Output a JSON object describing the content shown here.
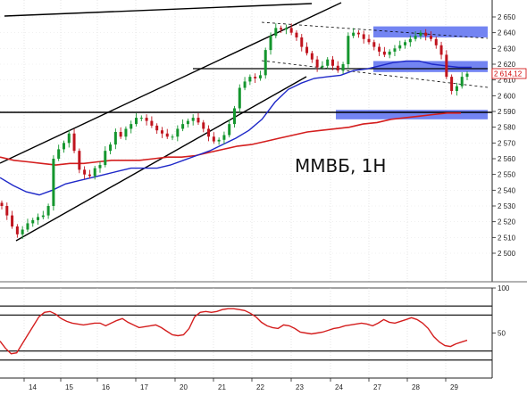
{
  "chart_data": [
    {
      "type": "candlestick",
      "title": "ММВБ, 1Н",
      "last_value_label": "2 614,12",
      "colors": {
        "up": "#14962e",
        "down": "#c0141e",
        "ma_slow": "#d41e1e",
        "ma_fast": "#1e28c8",
        "zone": "#5a6ef0",
        "lines": "#000000"
      },
      "ylim": [
        2495,
        2655
      ],
      "y_ticks": [
        "2 650",
        "2 640",
        "2 630",
        "2 620",
        "2 610",
        "2 600",
        "2 590",
        "2 580",
        "2 570",
        "2 560",
        "2 550",
        "2 540",
        "2 530",
        "2 520",
        "2 510",
        "2 500"
      ],
      "x_ticks": [
        "14",
        "15",
        "16",
        "17",
        "20",
        "21",
        "22",
        "23",
        "24",
        "27",
        "28",
        "29"
      ],
      "hourly_closes": [
        2530,
        2524,
        2517,
        2512,
        2515,
        2519,
        2521,
        2523,
        2524,
        2530,
        2560,
        2566,
        2570,
        2576,
        2565,
        2553,
        2550,
        2549,
        2554,
        2556,
        2565,
        2569,
        2577,
        2574,
        2579,
        2582,
        2586,
        2586,
        2584,
        2581,
        2578,
        2576,
        2574,
        2574,
        2579,
        2582,
        2584,
        2586,
        2583,
        2579,
        2574,
        2571,
        2572,
        2575,
        2582,
        2592,
        2605,
        2609,
        2612,
        2611,
        2613,
        2629,
        2638,
        2643,
        2642,
        2643,
        2640,
        2637,
        2631,
        2627,
        2623,
        2618,
        2619,
        2623,
        2619,
        2616,
        2620,
        2638,
        2640,
        2639,
        2636,
        2634,
        2631,
        2628,
        2626,
        2628,
        2630,
        2632,
        2634,
        2636,
        2638,
        2640,
        2638,
        2636,
        2632,
        2626,
        2612,
        2603,
        2606,
        2612,
        2614
      ],
      "moving_average_slow": [
        2561,
        2559,
        2558,
        2557,
        2556,
        2557,
        2557,
        2558,
        2559,
        2559,
        2559,
        2560,
        2561,
        2561,
        2562,
        2564,
        2566,
        2568,
        2569,
        2571,
        2573,
        2575,
        2577,
        2578,
        2579,
        2580,
        2582,
        2583,
        2585,
        2586,
        2587,
        2588,
        2589,
        2589
      ],
      "moving_average_fast": [
        2548,
        2543,
        2539,
        2537,
        2540,
        2544,
        2546,
        2548,
        2550,
        2552,
        2554,
        2554,
        2554,
        2556,
        2559,
        2562,
        2565,
        2569,
        2573,
        2578,
        2585,
        2596,
        2604,
        2608,
        2611,
        2612,
        2613,
        2616,
        2617,
        2619,
        2621,
        2622,
        2622,
        2620,
        2619,
        2618,
        2618
      ],
      "zones": [
        {
          "from": 2637,
          "to": 2644
        },
        {
          "from": 2615,
          "to": 2622
        },
        {
          "from": 2585,
          "to": 2591
        }
      ]
    },
    {
      "type": "line",
      "name": "oscillator",
      "ylim": [
        0,
        100
      ],
      "y_ticks": [
        "100",
        "50"
      ],
      "levels": [
        80,
        70,
        30,
        20
      ],
      "values": [
        41,
        33,
        27,
        28,
        38,
        48,
        58,
        68,
        73,
        74,
        71,
        66,
        63,
        61,
        60,
        59,
        60,
        61,
        61,
        58,
        61,
        64,
        66,
        62,
        59,
        56,
        57,
        58,
        59,
        56,
        52,
        48,
        47,
        48,
        55,
        68,
        73,
        74,
        73,
        74,
        76,
        77,
        77,
        76,
        75,
        72,
        68,
        62,
        58,
        56,
        55,
        59,
        58,
        55,
        51,
        50,
        49,
        50,
        51,
        53,
        55,
        56,
        58,
        59,
        60,
        61,
        60,
        58,
        61,
        65,
        62,
        61,
        63,
        65,
        67,
        65,
        61,
        55,
        46,
        40,
        36,
        35,
        38,
        40,
        42
      ]
    }
  ]
}
